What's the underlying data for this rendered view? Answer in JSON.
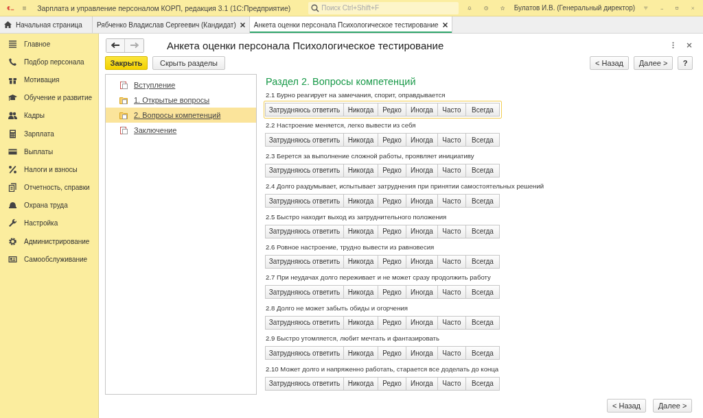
{
  "app_bar": {
    "title": "Зарплата и управление персоналом КОРП, редакция 3.1  (1С:Предприятие)",
    "search": {
      "placeholder": "Поиск Ctrl+Shift+F"
    },
    "user": "Булатов И.В. (Генеральный директор)"
  },
  "tabs": [
    {
      "label": "Начальная страница",
      "selected": false,
      "closable": false
    },
    {
      "label": "Рябченко Владислав Сергеевич (Кандидат)",
      "selected": false,
      "closable": true
    },
    {
      "label": "Анкета оценки персонала Психологическое тестирование",
      "selected": true,
      "closable": true
    }
  ],
  "sidebar": {
    "items": [
      {
        "label": "Главное"
      },
      {
        "label": "Подбор персонала"
      },
      {
        "label": "Мотивация"
      },
      {
        "label": "Обучение и развитие"
      },
      {
        "label": "Кадры"
      },
      {
        "label": "Зарплата"
      },
      {
        "label": "Выплаты"
      },
      {
        "label": "Налоги и взносы"
      },
      {
        "label": "Отчетность, справки"
      },
      {
        "label": "Охрана труда"
      },
      {
        "label": "Настройка"
      },
      {
        "label": "Администрирование"
      },
      {
        "label": "Самообслуживание"
      }
    ]
  },
  "form": {
    "title": "Анкета оценки персонала Психологическое тестирование",
    "close_button": "Закрыть",
    "hide_button": "Скрыть разделы",
    "back_button": "< Назад",
    "next_button": "Далее >",
    "help_button": "?",
    "sections": [
      {
        "label": "Вступление",
        "kind": "page",
        "selected": false
      },
      {
        "label": "1. Открытые вопросы",
        "kind": "folder",
        "selected": false
      },
      {
        "label": "2. Вопросы компетенций",
        "kind": "folder",
        "selected": true
      },
      {
        "label": "Заключение",
        "kind": "page",
        "selected": false
      }
    ],
    "section_title": "Раздел 2. Вопросы компетенций",
    "questions": [
      {
        "text": "2.1 Бурно реагирует на замечания, спорит, оправдывается",
        "focused": true,
        "options": [
          "Затрудняюсь ответить",
          "Никогда",
          "Редко",
          "Иногда",
          "Часто",
          "Всегда"
        ]
      },
      {
        "text": "2.2 Настроение меняется, легко вывести из себя",
        "focused": false,
        "options": [
          "Затрудняюсь ответить",
          "Никогда",
          "Редко",
          "Иногда",
          "Часто",
          "Всегда"
        ]
      },
      {
        "text": "2.3 Берется за выполнение сложной работы, проявляет инициативу",
        "focused": false,
        "options": [
          "Затрудняюсь ответить",
          "Никогда",
          "Редко",
          "Иногда",
          "Часто",
          "Всегда"
        ]
      },
      {
        "text": "2.4 Долго раздумывает, испытывает затруднения при принятии самостоятельных решений",
        "focused": false,
        "options": [
          "Затрудняюсь ответить",
          "Никогда",
          "Редко",
          "Иногда",
          "Часто",
          "Всегда"
        ]
      },
      {
        "text": "2.5 Быстро находит выход из затруднительного положения",
        "focused": false,
        "options": [
          "Затрудняюсь ответить",
          "Никогда",
          "Редко",
          "Иногда",
          "Часто",
          "Всегда"
        ]
      },
      {
        "text": "2.6 Ровное настроение, трудно вывести из равновесия",
        "focused": false,
        "options": [
          "Затрудняюсь ответить",
          "Никогда",
          "Редко",
          "Иногда",
          "Часто",
          "Всегда"
        ]
      },
      {
        "text": "2.7 При неудачах долго переживает и не может сразу продолжить работу",
        "focused": false,
        "options": [
          "Затрудняюсь ответить",
          "Никогда",
          "Редко",
          "Иногда",
          "Часто",
          "Всегда"
        ]
      },
      {
        "text": "2.8 Долго не может забыть обиды и огорчения",
        "focused": false,
        "options": [
          "Затрудняюсь ответить",
          "Никогда",
          "Редко",
          "Иногда",
          "Часто",
          "Всегда"
        ]
      },
      {
        "text": "2.9 Быстро утомляется, любит мечтать и фантазировать",
        "focused": false,
        "options": [
          "Затрудняюсь ответить",
          "Никогда",
          "Редко",
          "Иногда",
          "Часто",
          "Всегда"
        ]
      },
      {
        "text": "2.10 Может долго и напряженно работать, старается все доделать до конца",
        "focused": false,
        "options": [
          "Затрудняюсь ответить",
          "Никогда",
          "Редко",
          "Иногда",
          "Часто",
          "Всегда"
        ]
      }
    ],
    "footer_back_button": "< Назад",
    "footer_next_button": "Далее >"
  }
}
